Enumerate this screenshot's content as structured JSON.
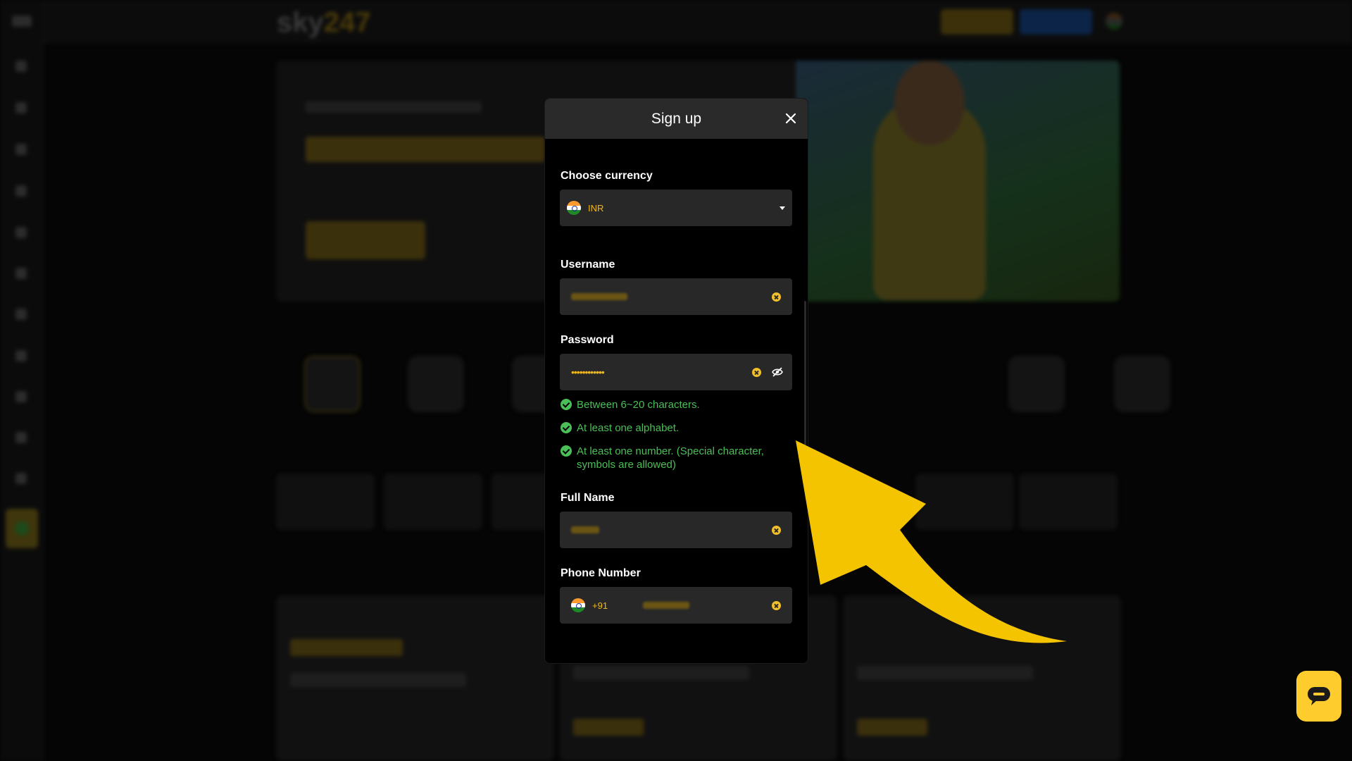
{
  "modal": {
    "title": "Sign up",
    "currency_label": "Choose currency",
    "currency_value": "INR",
    "username_label": "Username",
    "password_label": "Password",
    "password_value": "••••••••••••",
    "rules": [
      "Between 6~20 characters.",
      "At least one alphabet.",
      "At least one number. (Special character, symbols are allowed)"
    ],
    "fullname_label": "Full Name",
    "phone_label": "Phone Number",
    "phone_code": "+91"
  },
  "colors": {
    "accent_yellow": "#f5c400",
    "rule_green": "#4bbf57",
    "field_bg": "#282828",
    "header_bg": "#2a2a2a"
  },
  "icons": [
    "close-icon",
    "india-flag-icon",
    "chevron-down-icon",
    "clear-icon",
    "eye-off-icon",
    "check-circle-icon",
    "chat-icon",
    "arrow-annotation"
  ]
}
